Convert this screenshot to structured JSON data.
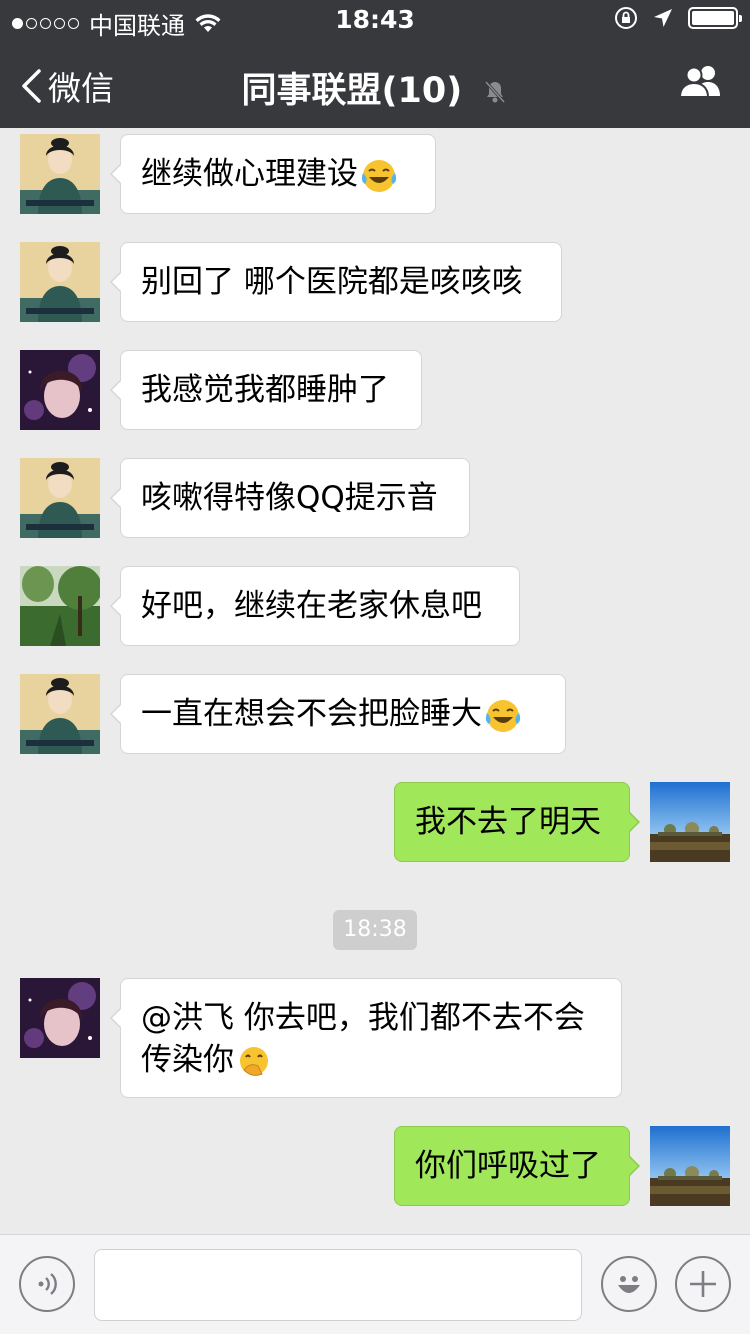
{
  "status_bar": {
    "carrier": "中国联通",
    "time": "18:43"
  },
  "nav": {
    "back_label": "微信",
    "title": "同事联盟(10)"
  },
  "messages": [
    {
      "side": "left",
      "avatar": "portrait-lady-avatar",
      "text": "继续做心理建设",
      "emoji": "tears-of-joy"
    },
    {
      "side": "left",
      "avatar": "portrait-lady-avatar",
      "text": "别回了 哪个医院都是咳咳咳"
    },
    {
      "side": "left",
      "avatar": "girl-photo-avatar",
      "text": "我感觉我都睡肿了"
    },
    {
      "side": "left",
      "avatar": "portrait-lady-avatar",
      "text": "咳嗽得特像QQ提示音"
    },
    {
      "side": "left",
      "avatar": "park-photo-avatar",
      "text": "好吧，继续在老家休息吧"
    },
    {
      "side": "left",
      "avatar": "portrait-lady-avatar",
      "text": "一直在想会不会把脸睡大",
      "emoji": "tears-of-joy"
    },
    {
      "side": "right",
      "avatar": "landscape-avatar",
      "text": "我不去了明天"
    },
    {
      "timestamp": "18:38"
    },
    {
      "side": "left",
      "avatar": "girl-photo-avatar",
      "text_line1": "@洪飞 你去吧，我们都不去不会",
      "text_line2": "传染你",
      "emoji": "hand-over-mouth"
    },
    {
      "side": "right",
      "avatar": "landscape-avatar",
      "text": "你们呼吸过了"
    }
  ],
  "input_bar": {
    "placeholder": "",
    "value": ""
  },
  "colors": {
    "nav_bg": "#37393d",
    "chat_bg": "#ebebeb",
    "sent_bubble": "#a0e75a",
    "received_bubble": "#ffffff"
  }
}
